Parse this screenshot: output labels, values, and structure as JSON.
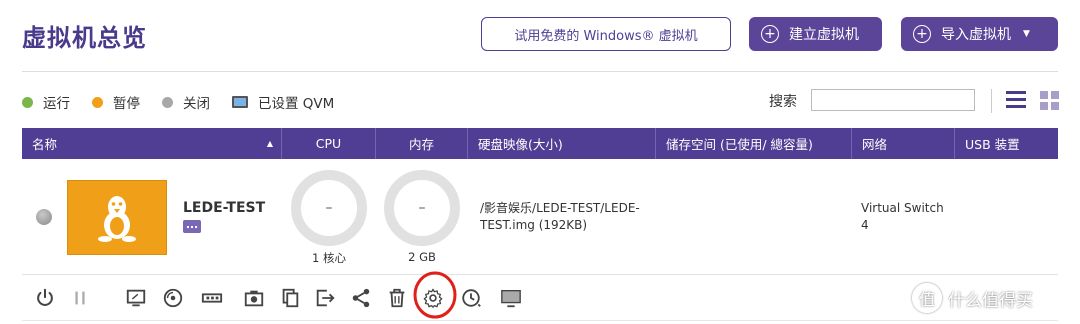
{
  "header": {
    "title": "虚拟机总览",
    "try_windows_label": "试用免费的 Windows® 虚拟机",
    "create_vm_label": "建立虚拟机",
    "import_vm_label": "导入虚拟机"
  },
  "legend": [
    {
      "label": "运行",
      "color": "#7ab648"
    },
    {
      "label": "暂停",
      "color": "#f0a018"
    },
    {
      "label": "关闭",
      "color": "#a8a8a8"
    },
    {
      "label": "已设置 QVM"
    }
  ],
  "search": {
    "label": "搜索",
    "value": ""
  },
  "table": {
    "columns": [
      "名称",
      "CPU",
      "内存",
      "硬盘映像(大小)",
      "储存空间 (已使用/ 總容量)",
      "网络",
      "USB 装置"
    ],
    "rows": [
      {
        "name": "LEDE-TEST",
        "cpu_value": "–",
        "cpu_label": "1 核心",
        "mem_value": "–",
        "mem_label": "2 GB",
        "disk": "/影音娱乐/LEDE-TEST/LEDE-TEST.img (192KB)",
        "network_line1": "Virtual Switch",
        "network_line2": "4"
      }
    ]
  },
  "watermark": {
    "icon": "值",
    "text": "什么值得买"
  },
  "colors": {
    "accent": "#4f3e93",
    "thumb": "#f0a018",
    "highlight_circle": "#e0201b"
  }
}
